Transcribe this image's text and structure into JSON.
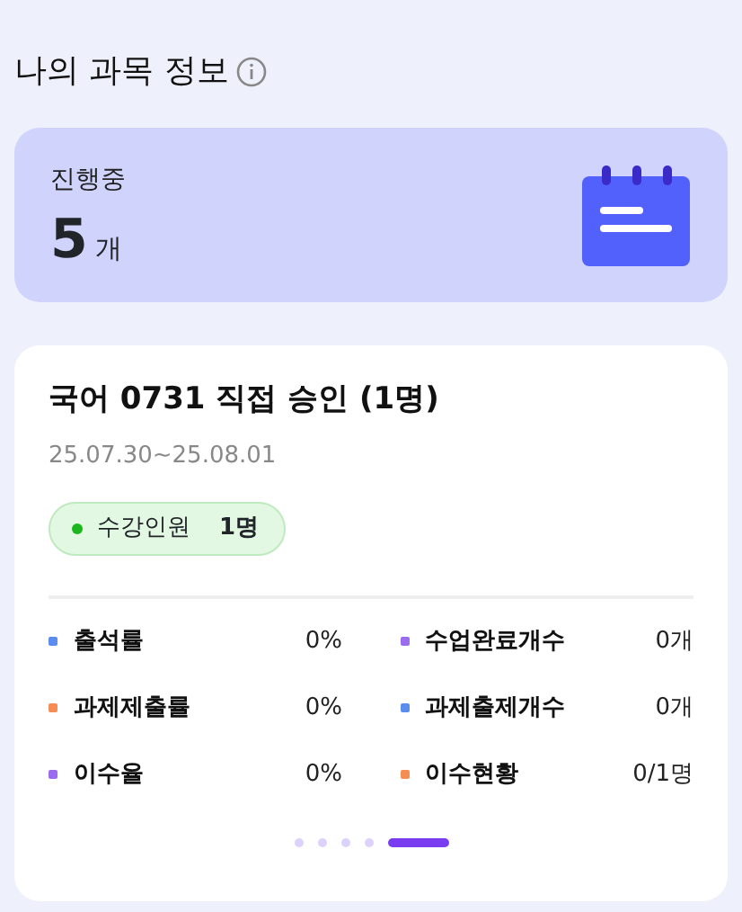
{
  "section_title": "나의 과목 정보",
  "summary": {
    "label": "진행중",
    "count": "5",
    "unit": "개"
  },
  "course": {
    "title": "국어 0731 직접 승인 (1명)",
    "period": "25.07.30~25.08.01",
    "enrollment": {
      "label": "수강인원",
      "value": "1명",
      "color": "#1db61d"
    },
    "stats": [
      {
        "label": "출석률",
        "value": "0%",
        "color": "#5b8def"
      },
      {
        "label": "수업완료개수",
        "value": "0개",
        "color": "#9b6cf0"
      },
      {
        "label": "과제제출률",
        "value": "0%",
        "color": "#f58d55"
      },
      {
        "label": "과제출제개수",
        "value": "0개",
        "color": "#5b8def"
      },
      {
        "label": "이수율",
        "value": "0%",
        "color": "#9b6cf0"
      },
      {
        "label": "이수현황",
        "value": "0/1명",
        "color": "#f58d55"
      }
    ],
    "pages": [
      {
        "selected": false
      },
      {
        "selected": false
      },
      {
        "selected": false
      },
      {
        "selected": false
      },
      {
        "selected": true
      }
    ]
  }
}
